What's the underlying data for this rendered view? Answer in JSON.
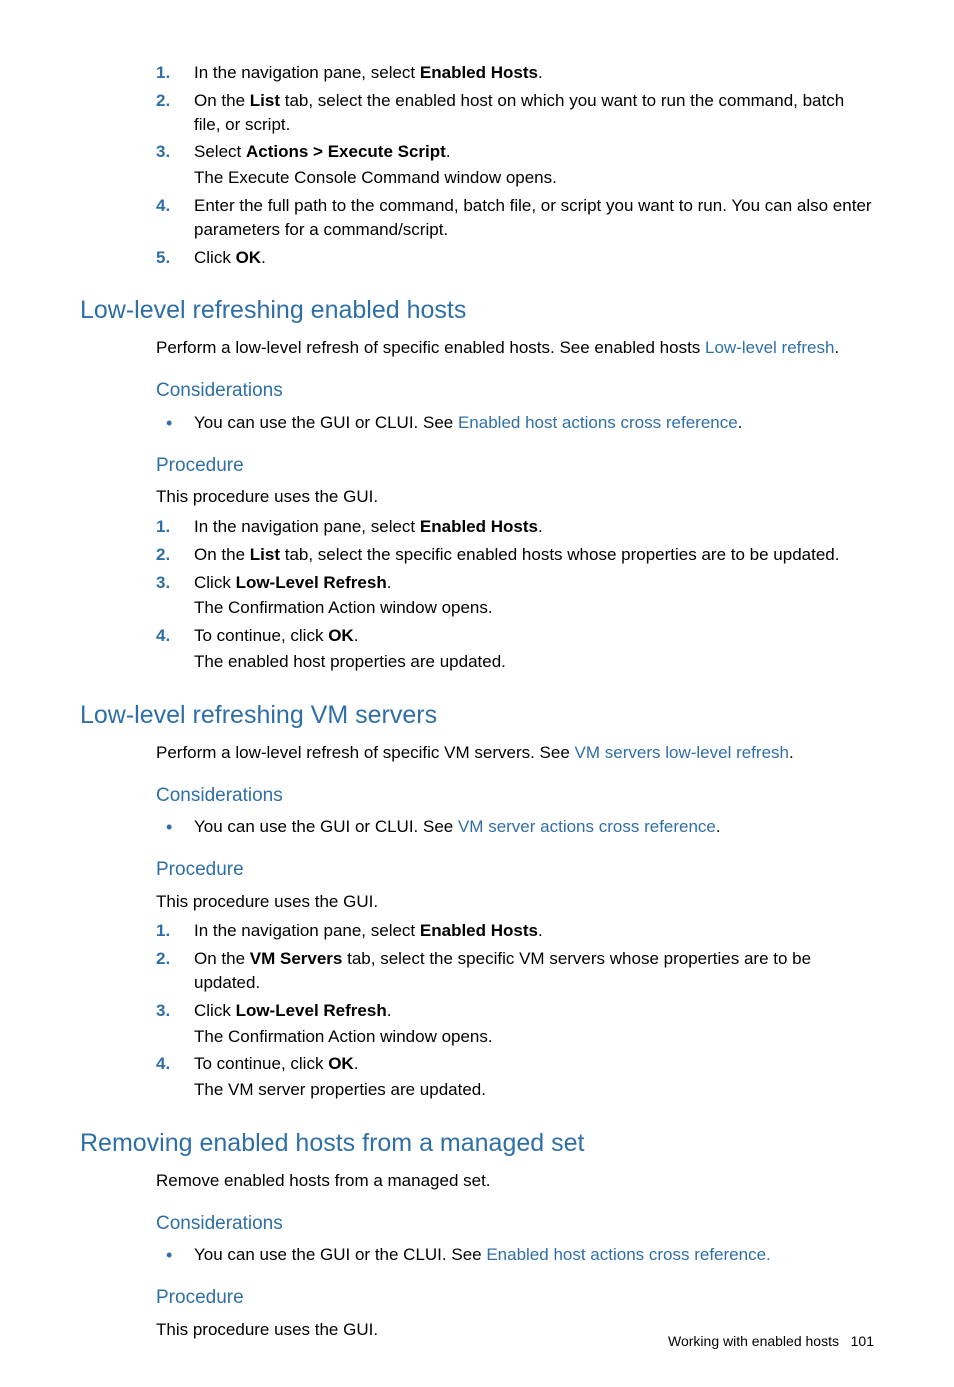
{
  "intro_steps": [
    {
      "num": "1.",
      "html": "In the navigation pane, select <b>Enabled Hosts</b>."
    },
    {
      "num": "2.",
      "html": "On the <b>List</b> tab, select the enabled host on which you want to run the command, batch file, or script."
    },
    {
      "num": "3.",
      "html": "Select <b>Actions > Execute Script</b>.",
      "sub": "The Execute Console Command window opens."
    },
    {
      "num": "4.",
      "html": "Enter the full path to the command, batch file, or script you want to run. You can also enter parameters for a command/script."
    },
    {
      "num": "5.",
      "html": "Click <b>OK</b>."
    }
  ],
  "sec1": {
    "heading": "Low-level refreshing enabled hosts",
    "intro_pre": "Perform a low-level refresh of specific enabled hosts. See enabled hosts ",
    "intro_link": "Low-level refresh",
    "intro_post": ".",
    "considerations_h": "Considerations",
    "cons_pre": "You can use the GUI or CLUI. See ",
    "cons_link": "Enabled host actions cross reference",
    "cons_post": ".",
    "procedure_h": "Procedure",
    "proc_intro": "This procedure uses the GUI.",
    "steps": [
      {
        "num": "1.",
        "html": "In the navigation pane, select <b>Enabled Hosts</b>."
      },
      {
        "num": "2.",
        "html": "On the <b>List</b> tab, select the specific enabled hosts whose properties are to be updated."
      },
      {
        "num": "3.",
        "html": "Click <b>Low-Level Refresh</b>.",
        "sub": "The Confirmation Action window opens."
      },
      {
        "num": "4.",
        "html": "To continue, click <b>OK</b>.",
        "sub": "The enabled host properties are updated."
      }
    ]
  },
  "sec2": {
    "heading": "Low-level refreshing VM servers",
    "intro_pre": "Perform a low-level refresh of specific VM servers. See ",
    "intro_link": "VM servers low-level refresh",
    "intro_post": ".",
    "considerations_h": "Considerations",
    "cons_pre": "You can use the GUI or CLUI. See ",
    "cons_link": "VM server actions cross reference",
    "cons_post": ".",
    "procedure_h": "Procedure",
    "proc_intro": "This procedure uses the GUI.",
    "steps": [
      {
        "num": "1.",
        "html": "In the navigation pane, select <b>Enabled Hosts</b>."
      },
      {
        "num": "2.",
        "html": "On the <b>VM Servers</b> tab, select the specific VM servers whose properties are to be updated."
      },
      {
        "num": "3.",
        "html": "Click <b>Low-Level Refresh</b>.",
        "sub": "The Confirmation Action window opens."
      },
      {
        "num": "4.",
        "html": "To continue, click <b>OK</b>.",
        "sub": "The VM server properties are updated."
      }
    ]
  },
  "sec3": {
    "heading": "Removing enabled hosts from a managed set",
    "intro": "Remove enabled hosts from a managed set.",
    "considerations_h": "Considerations",
    "cons_pre": "You can use the GUI or the CLUI. See ",
    "cons_link": "Enabled host actions cross reference.",
    "cons_post": "",
    "procedure_h": "Procedure",
    "proc_intro": "This procedure uses the GUI."
  },
  "footer": {
    "label": "Working with enabled hosts",
    "page": "101"
  }
}
